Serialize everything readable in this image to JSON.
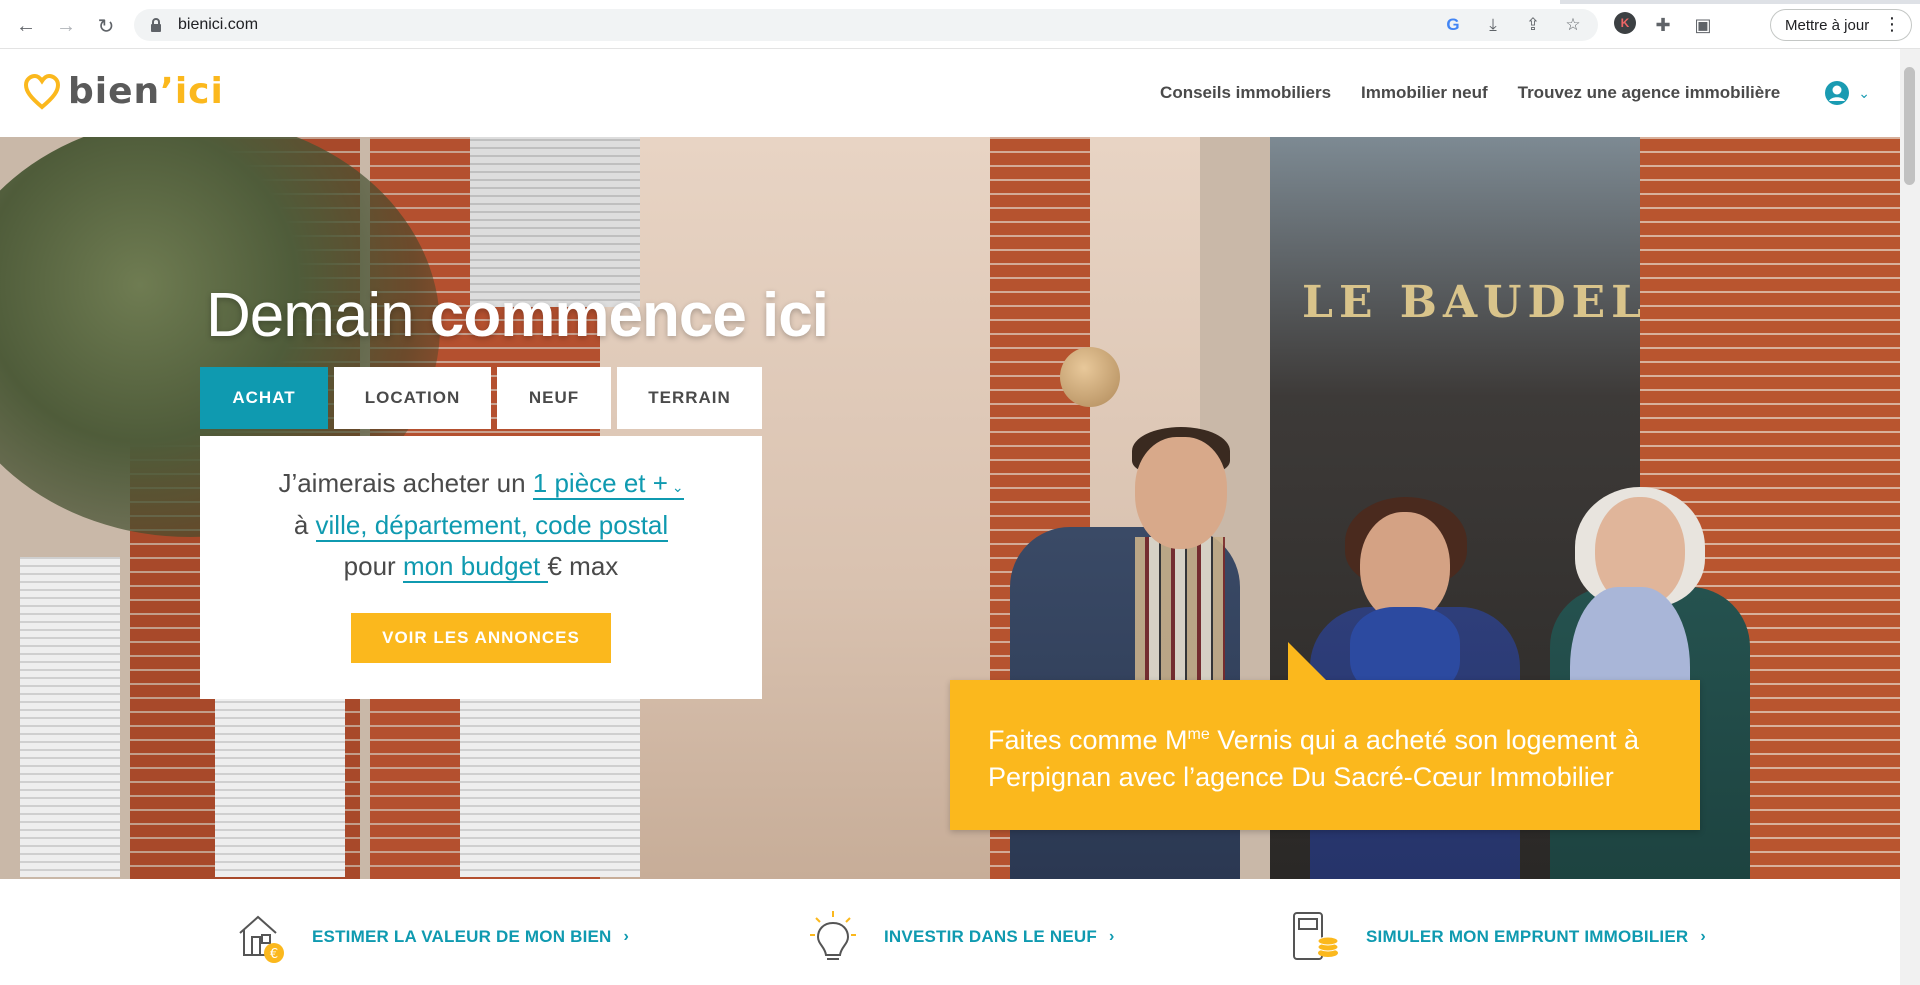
{
  "browser": {
    "url": "bienici.com",
    "update_button": "Mettre à jour",
    "profile_initial": "K"
  },
  "header": {
    "logo_prefix": "bien",
    "logo_apostrophe": "’",
    "logo_suffix": "ici",
    "nav": [
      {
        "label": "Conseils immobiliers"
      },
      {
        "label": "Immobilier neuf"
      },
      {
        "label": "Trouvez une agence immobilière"
      }
    ]
  },
  "hero": {
    "title_light": "Demain ",
    "title_bold": "commence ici",
    "sign_text": "LE BAUDELAIRE",
    "tabs": [
      {
        "label": "ACHAT",
        "active": true
      },
      {
        "label": "LOCATION",
        "active": false
      },
      {
        "label": "NEUF",
        "active": false
      },
      {
        "label": "TERRAIN",
        "active": false
      }
    ],
    "search": {
      "line1_prefix": "J’aimerais acheter un ",
      "rooms_value": "1 pièce et +",
      "line2_prefix": "à ",
      "location_placeholder": "ville, département, code postal",
      "line3_prefix": "pour ",
      "budget_placeholder": "mon budget ",
      "line3_suffix": "€ max",
      "cta_label": "VOIR LES ANNONCES"
    },
    "quote": {
      "part1": "Faites comme M",
      "sup": "me",
      "part2": " Vernis qui a acheté son logement à",
      "line2": "Perpignan avec l’agence Du Sacré-Cœur Immobilier"
    }
  },
  "features": [
    {
      "label": "ESTIMER LA VALEUR DE MON BIEN",
      "icon": "house-euro-icon"
    },
    {
      "label": "INVESTIR DANS LE NEUF",
      "icon": "lightbulb-icon"
    },
    {
      "label": "SIMULER MON EMPRUNT IMMOBILIER",
      "icon": "calculator-coins-icon"
    }
  ],
  "colors": {
    "accent": "#0f9ab0",
    "brand_yellow": "#fbb81d",
    "text": "#4a4a4a"
  }
}
